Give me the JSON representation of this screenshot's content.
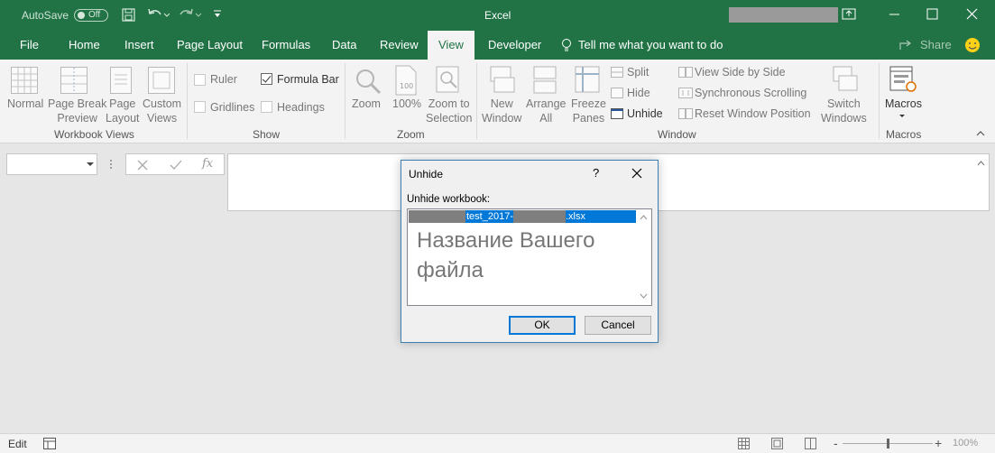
{
  "titlebar": {
    "autosave_label": "AutoSave",
    "autosave_state": "Off",
    "app_title": "Excel",
    "icons": [
      "save-icon",
      "undo-icon",
      "redo-icon",
      "customize-icon",
      "ribbon-display-icon",
      "minimize-icon",
      "maximize-icon",
      "close-icon"
    ]
  },
  "tabs": [
    {
      "label": "File"
    },
    {
      "label": "Home"
    },
    {
      "label": "Insert"
    },
    {
      "label": "Page Layout"
    },
    {
      "label": "Formulas"
    },
    {
      "label": "Data"
    },
    {
      "label": "Review"
    },
    {
      "label": "View",
      "active": true
    },
    {
      "label": "Developer"
    }
  ],
  "tell_me": "Tell me what you want to do",
  "share": "Share",
  "ribbon": {
    "workbook_views": {
      "label": "Workbook Views",
      "buttons": [
        {
          "line1": "Normal",
          "line2": ""
        },
        {
          "line1": "Page Break",
          "line2": "Preview"
        },
        {
          "line1": "Page",
          "line2": "Layout"
        },
        {
          "line1": "Custom",
          "line2": "Views"
        }
      ]
    },
    "show": {
      "label": "Show",
      "ruler": "Ruler",
      "formula_bar": "Formula Bar",
      "gridlines": "Gridlines",
      "headings": "Headings",
      "formula_bar_checked": true
    },
    "zoom": {
      "label": "Zoom",
      "zoom": "Zoom",
      "hundred": "100%",
      "zoom_sel_1": "Zoom to",
      "zoom_sel_2": "Selection"
    },
    "window": {
      "label": "Window",
      "new_1": "New",
      "new_2": "Window",
      "arrange_1": "Arrange",
      "arrange_2": "All",
      "freeze_1": "Freeze",
      "freeze_2": "Panes",
      "split": "Split",
      "hide": "Hide",
      "unhide": "Unhide",
      "side_by_side": "View Side by Side",
      "sync_scroll": "Synchronous Scrolling",
      "reset_pos": "Reset Window Position",
      "switch_1": "Switch",
      "switch_2": "Windows"
    },
    "macros": {
      "label": "Macros",
      "button": "Macros"
    }
  },
  "formula_bar": {
    "fx": "fx"
  },
  "dialog": {
    "title": "Unhide",
    "help": "?",
    "prompt": "Unhide workbook:",
    "selected_item_part1": "test_2017-",
    "selected_item_part2": ".xlsx",
    "overlay_text": "Название Вашего файла",
    "ok": "OK",
    "cancel": "Cancel"
  },
  "status": {
    "mode": "Edit",
    "zoom_minus": "-",
    "zoom_plus": "+",
    "zoom_level": "100%"
  },
  "colors": {
    "brand": "#217346",
    "selection": "#0078d7"
  }
}
